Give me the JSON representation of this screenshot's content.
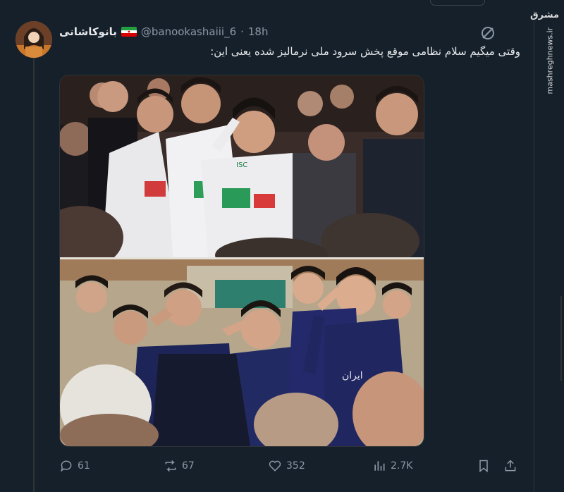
{
  "tweet": {
    "display_name": "بانوکاشانی",
    "handle": "@banookashaiii_6",
    "separator": "·",
    "time": "18h",
    "text": "وقتی میگیم سلام نظامی موقع پخش سرود ملی نرمالیز شده یعنی این:"
  },
  "media": {
    "top_jersey_logo": "ISC",
    "bottom_jersey_text": "ایران"
  },
  "watermark": {
    "logo_text": "مشرق",
    "site": "mashreghnews.ir"
  },
  "actions": {
    "replies": "61",
    "reposts": "67",
    "likes": "352",
    "views": "2.7K"
  },
  "colors": {
    "background": "#15202b",
    "text": "#e7e9ea",
    "muted": "#8b98a5",
    "border": "#2f3336"
  }
}
